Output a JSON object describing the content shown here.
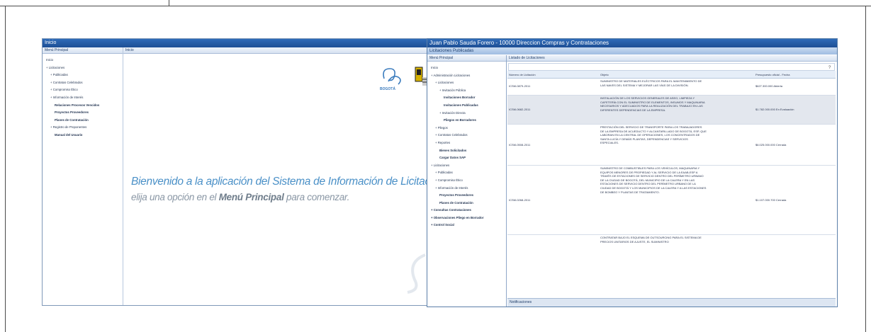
{
  "left_window": {
    "title": "Inicio",
    "menu_header": "Menú Principal",
    "content_header": "Inicio",
    "tree": [
      {
        "label": "Inicio",
        "indent": 0,
        "bold": false
      },
      {
        "label": "+ Licitaciones",
        "indent": 0,
        "bold": false
      },
      {
        "label": "+ Publicadas",
        "indent": 1,
        "bold": false
      },
      {
        "label": "+ Contratos Celebrados",
        "indent": 1,
        "bold": false
      },
      {
        "label": "+ Compromiso Ético",
        "indent": 1,
        "bold": false
      },
      {
        "label": "+ Información de Interés",
        "indent": 1,
        "bold": false
      },
      {
        "label": "Relaciones Procesos Vencidos",
        "indent": 2,
        "bold": true
      },
      {
        "label": "Proyectos Proveedores",
        "indent": 2,
        "bold": true
      },
      {
        "label": "Planes de Contratación",
        "indent": 2,
        "bold": true
      },
      {
        "label": "+ Registro de Proponentes",
        "indent": 1,
        "bold": false
      },
      {
        "label": "Manual del Usuario",
        "indent": 2,
        "bold": true
      }
    ],
    "welcome_line1": "Bienvenido a la aplicación del Sistema de Información de Licitaciones (SIL),",
    "welcome_line2_pre": "elija una opción en el ",
    "welcome_line2_bold": "Menú Principal",
    "welcome_line2_post": " para comenzar.",
    "logo_caption": "BOGOTÁ"
  },
  "right_window": {
    "title": "Juan Pablo Sauda Forero - 10000 Direccion Compras y Contrataciones",
    "subtitle": "Licitaciones Publicadas",
    "menu_header": "Menú Principal",
    "content_header": "Listado de Licitaciones",
    "tree": [
      {
        "label": "Inicio",
        "indent": 0,
        "bold": false
      },
      {
        "label": "+ Administración Licitaciones",
        "indent": 0,
        "bold": false
      },
      {
        "label": "+ Licitaciones",
        "indent": 1,
        "bold": false
      },
      {
        "label": "+ Invitación Pública",
        "indent": 2,
        "bold": false
      },
      {
        "label": "Invitaciones Borrador",
        "indent": 3,
        "bold": true
      },
      {
        "label": "Invitaciones Publicadas",
        "indent": 3,
        "bold": true
      },
      {
        "label": "+ Invitación Directa",
        "indent": 2,
        "bold": false
      },
      {
        "label": "Pliegos en Borradores",
        "indent": 3,
        "bold": true
      },
      {
        "label": "+ Pliegos",
        "indent": 1,
        "bold": false
      },
      {
        "label": "+ Contratos Celebrados",
        "indent": 1,
        "bold": false
      },
      {
        "label": "+ Reportes",
        "indent": 1,
        "bold": false
      },
      {
        "label": "Bienes Solicitados",
        "indent": 2,
        "bold": true
      },
      {
        "label": "Cargar Datos SAP",
        "indent": 2,
        "bold": true
      },
      {
        "label": "+ Licitaciones",
        "indent": 0,
        "bold": false
      },
      {
        "label": "+ Publicadas",
        "indent": 1,
        "bold": false
      },
      {
        "label": "+ Compromiso Ético",
        "indent": 1,
        "bold": false
      },
      {
        "label": "+ Información de Interés",
        "indent": 1,
        "bold": false
      },
      {
        "label": "Proyectos Proveedores",
        "indent": 2,
        "bold": true
      },
      {
        "label": "Planes de Contratación",
        "indent": 2,
        "bold": true
      },
      {
        "label": "+ Consultas Contrataciones",
        "indent": 0,
        "bold": true
      },
      {
        "label": "+ Observaciones Pliego en Borrador",
        "indent": 0,
        "bold": true
      },
      {
        "label": "+ Control Social",
        "indent": 0,
        "bold": true
      }
    ],
    "table": {
      "columns": [
        "Número de Licitación",
        "Objeto",
        "Presupuesto oficial - Fecha"
      ],
      "rows": [
        {
          "numero": "ICSM-0879-2011",
          "objeto": "SUMINISTRO DE MATERIALES ELÉCTRICOS PARA EL MANTENIMIENTO DE LAS NAVES DEL SISTEMA Y MEJORAR LAS VÍAS DE LA DIVISIÓN.",
          "presupuesto": "$627.300.000 Abierta"
        },
        {
          "numero": "ICSM-0682-2011",
          "objeto": "INSTALACIÓN DE LOS SERVICIOS GENERALES DE ASEO, LIMPIEZA Y CAFETERÍA CON EL SUMINISTRO DE ELEMENTOS, INSUMOS Y MAQUINARIA NECESARIOS Y ADECUADOS PARA LA REALIZACIÓN DEL TRABAJO EN LAS DIFERENTES DEPENDENCIAS DE LA EMPRESA.",
          "presupuesto": "$1.782.000.000 En Evaluación"
        },
        {
          "numero": "ICSM-0508-2011",
          "objeto": "PRESTACIÓN DEL SERVICIO DE TRANSPORTE PARA LOS TRABAJADORES DE LA EMPRESA DE ACUEDUCTO Y ALCANTARILLADO DE BOGOTÁ, ESP, QUE LABORAN EN LA CENTRAL DE OPERACIONES, LOS CONCENTRADOS DE SANTA LUCÍA Y DEMÁS PLANTAS, DEPENDENCIAS Y SERVICIOS ESPECIALES.",
          "presupuesto": "$6.025.000.000 Cerrada"
        },
        {
          "numero": "ICSM-0268-2011",
          "objeto": "SUMINISTRO DE COMBUSTIBLES PARA LOS VEHÍCULOS, MAQUINARIA Y EQUIPOS MENORES DE PROPIEDAD Y AL SERVICIO DE LA EAAB-ESP A TRAVÉS DE ESTACIONES DE SERVICIO DENTRO DEL PERÍMETRO URBANO DE LA CIUDAD DE BOGOTÁ, DEL MUNICIPIO DE LA CALERA Y EN LAS ESTACIONES DE SERVICIO DENTRO DEL PERÍMETRO URBANO DE LA CIUDAD DE BOGOTÁ Y LOS MUNICIPIOS DE LA CALERA Y A LAS ESTACIONES DE BOMBEO Y PLANTAS DE TRATAMIENTO.",
          "presupuesto": "$1.107.000.700 Cerrada"
        },
        {
          "numero": "",
          "objeto": "CONTRATAR BAJO EL ESQUEMA DE OUTSOURCING PARA EL SISTEMA DE PRECIOS UNITARIOS DE AJUSTE, EL SUMINISTRO",
          "presupuesto": ""
        }
      ]
    },
    "footer": "Notificaciones"
  }
}
